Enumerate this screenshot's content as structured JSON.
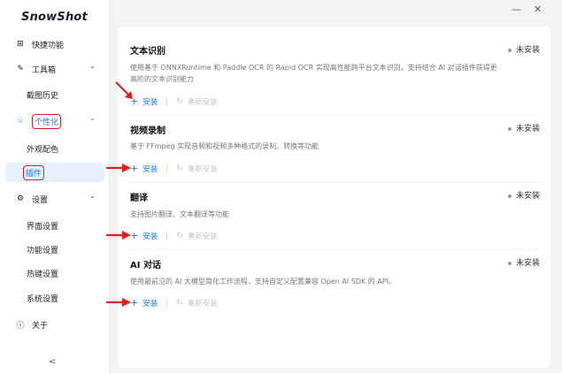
{
  "app": {
    "logo": "SnowShot"
  },
  "window": {
    "minimize": "—",
    "close": "✕"
  },
  "sidebar": {
    "items": [
      {
        "label": "快捷功能",
        "icon": "grid-icon"
      },
      {
        "label": "工具箱",
        "icon": "wrench-icon"
      },
      {
        "label": "截图历史"
      },
      {
        "label": "个性化",
        "icon": "paint-icon"
      },
      {
        "label": "外观配色"
      },
      {
        "label": "插件"
      },
      {
        "label": "设置",
        "icon": "gear-icon"
      },
      {
        "label": "界面设置"
      },
      {
        "label": "功能设置"
      },
      {
        "label": "热键设置"
      },
      {
        "label": "系统设置"
      },
      {
        "label": "关于",
        "icon": "info-icon"
      }
    ],
    "collapse": "<"
  },
  "plugins": [
    {
      "title": "文本识别",
      "status": "未安装",
      "desc": "使用基于 ONNXRuntime 和 Paddle OCR 的 Rapid OCR 实现高性能跨平台文本识别。支持结合 AI 对话插件获得更高阶的文本识别能力",
      "install": "安装",
      "reinstall": "重新安装"
    },
    {
      "title": "视频录制",
      "status": "未安装",
      "desc": "基于 FFmpeg 实现音频和视频多种格式的录制、转换等功能",
      "install": "安装",
      "reinstall": "重新安装"
    },
    {
      "title": "翻译",
      "status": "未安装",
      "desc": "支持图片翻译、文本翻译等功能",
      "install": "安装",
      "reinstall": "重新安装"
    },
    {
      "title": "AI 对话",
      "status": "未安装",
      "desc": "使用最前沿的 AI 大模型简化工作流程，支持自定义配置兼容 Open AI SDK 的 API。",
      "install": "安装",
      "reinstall": "重新安装"
    }
  ],
  "colors": {
    "accent": "#1677ff",
    "annotation": "#e02020"
  }
}
